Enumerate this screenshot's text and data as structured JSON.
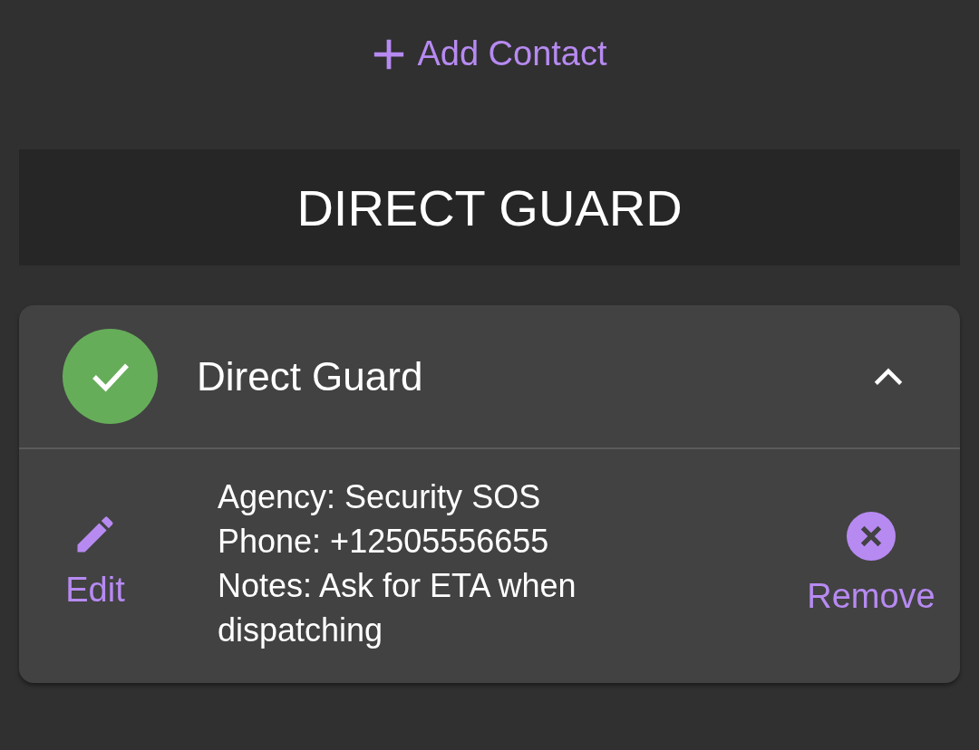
{
  "add_button": {
    "label": "Add Contact"
  },
  "section_title": "DIRECT GUARD",
  "contacts": [
    {
      "name": "Direct Guard",
      "verified": true,
      "expanded": true,
      "details": [
        "Agency: Security SOS",
        "Phone: +12505556655",
        "Notes: Ask for ETA when dispatching"
      ],
      "edit_label": "Edit",
      "remove_label": "Remove"
    }
  ]
}
